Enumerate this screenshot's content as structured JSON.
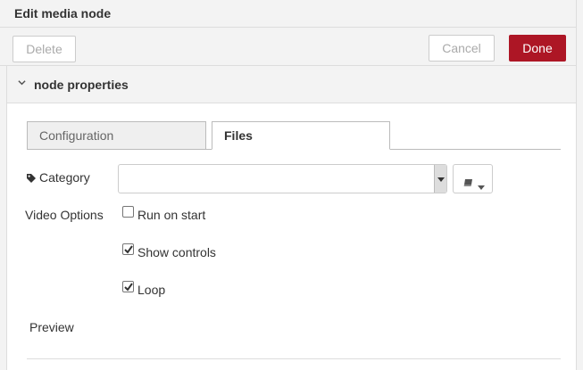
{
  "dialog": {
    "title": "Edit media node"
  },
  "toolbar": {
    "delete_label": "Delete",
    "cancel_label": "Cancel",
    "done_label": "Done"
  },
  "section": {
    "title": "node properties",
    "chevron_icon": "chevron-down-icon"
  },
  "tabs": [
    {
      "label": "Configuration",
      "active": false
    },
    {
      "label": "Files",
      "active": true
    }
  ],
  "form": {
    "category": {
      "label": "Category",
      "icon": "tag-icon",
      "value": "",
      "library_button_icon": "book-icon"
    },
    "video_options": {
      "label": "Video Options",
      "options": [
        {
          "label": "Run on start",
          "checked": false
        },
        {
          "label": "Show controls",
          "checked": true
        },
        {
          "label": "Loop",
          "checked": true
        }
      ]
    },
    "preview_label": "Preview"
  },
  "colors": {
    "accent": "#ad1625",
    "panel_bg": "#f3f3f3",
    "border": "#cccccc"
  }
}
